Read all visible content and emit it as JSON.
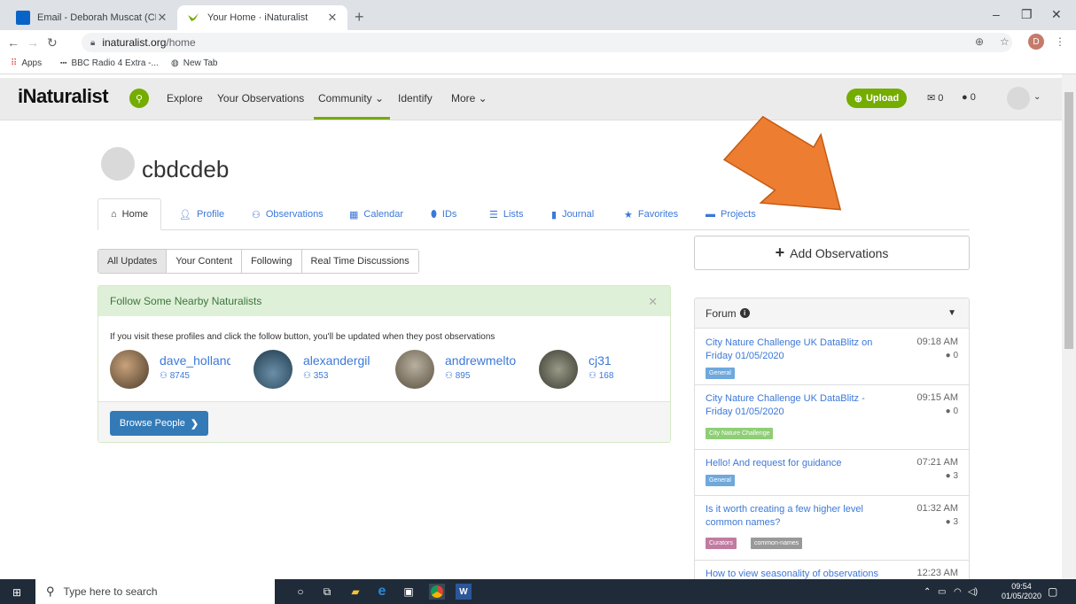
{
  "browser": {
    "tabs": [
      {
        "title": "Email - Deborah Muscat (CBDC)",
        "icon": "outlook-icon"
      },
      {
        "title": "Your Home · iNaturalist",
        "icon": "inaturalist-bird-icon"
      }
    ],
    "url_host": "inaturalist.org",
    "url_path": "/home",
    "avatar_letter": "D",
    "bookmarks": [
      "Apps",
      "BBC Radio 4 Extra -...",
      "New Tab"
    ]
  },
  "header": {
    "logo": "iNaturalist",
    "nav": [
      "Explore",
      "Your Observations",
      "Community ⌄",
      "Identify",
      "More ⌄"
    ],
    "upload": "Upload",
    "messages_count": "0",
    "notifications_count": "0",
    "accent": "#74ac00"
  },
  "profile": {
    "username": "cbdcdeb",
    "tabs": [
      "Home",
      "Profile",
      "Observations",
      "Calendar",
      "IDs",
      "Lists",
      "Journal",
      "Favorites",
      "Projects"
    ],
    "active_tab": "Home"
  },
  "filters": [
    "All Updates",
    "Your Content",
    "Following",
    "Real Time Discussions"
  ],
  "nearby": {
    "title": "Follow Some Nearby Naturalists",
    "description": "If you visit these profiles and click the follow button, you'll be updated when they post observations",
    "users": [
      {
        "name": "dave_holland",
        "count": "8745"
      },
      {
        "name": "alexandergil",
        "count": "353"
      },
      {
        "name": "andrewmelton",
        "count": "895"
      },
      {
        "name": "cj31",
        "count": "168"
      }
    ],
    "browse": "Browse People"
  },
  "add_observations": "Add Observations",
  "forum": {
    "title": "Forum",
    "topics": [
      {
        "title": "City Nature Challenge UK DataBlitz on Friday 01/05/2020",
        "time": "09:18 AM",
        "replies": "0",
        "tags": [
          "General"
        ]
      },
      {
        "title": "City Nature Challenge UK DataBlitz - Friday 01/05/2020",
        "time": "09:15 AM",
        "replies": "0",
        "tags": [
          "City Nature Challenge"
        ]
      },
      {
        "title": "Hello! And request for guidance",
        "time": "07:21 AM",
        "replies": "3",
        "tags": [
          "General"
        ]
      },
      {
        "title": "Is it worth creating a few higher level common names?",
        "time": "01:32 AM",
        "replies": "3",
        "tags": [
          "Curators",
          "common-names"
        ]
      },
      {
        "title": "How to view seasonality of observations",
        "time": "12:23 AM",
        "replies": "",
        "tags": []
      }
    ],
    "tag_colors": {
      "General": "#6fa8dc",
      "City Nature Challenge": "#8fce76",
      "Curators": "#c27ba0",
      "common-names": "#999999"
    }
  },
  "taskbar": {
    "search_placeholder": "Type here to search",
    "time": "09:54",
    "date": "01/05/2020"
  }
}
